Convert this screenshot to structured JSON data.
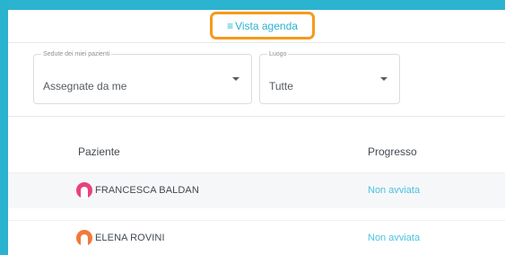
{
  "agenda": {
    "label": "Vista agenda",
    "icon": "list-icon"
  },
  "filters": {
    "sedute": {
      "label": "Sedute dei miei pazienti",
      "value": "Assegnate da me"
    },
    "luogo": {
      "label": "Luogo",
      "value": "Tutte"
    }
  },
  "table": {
    "headers": {
      "patient": "Paziente",
      "progress": "Progresso"
    },
    "rows": [
      {
        "name": "FRANCESCA BALDAN",
        "progress": "Non avviata",
        "avatar_color": "#e8427a"
      },
      {
        "name": "ELENA ROVINI",
        "progress": "Non avviata",
        "avatar_color": "#f07a3a"
      }
    ]
  },
  "colors": {
    "frame": "#2ab3cf",
    "highlight": "#f59a1b",
    "link": "#4bc3e0"
  }
}
